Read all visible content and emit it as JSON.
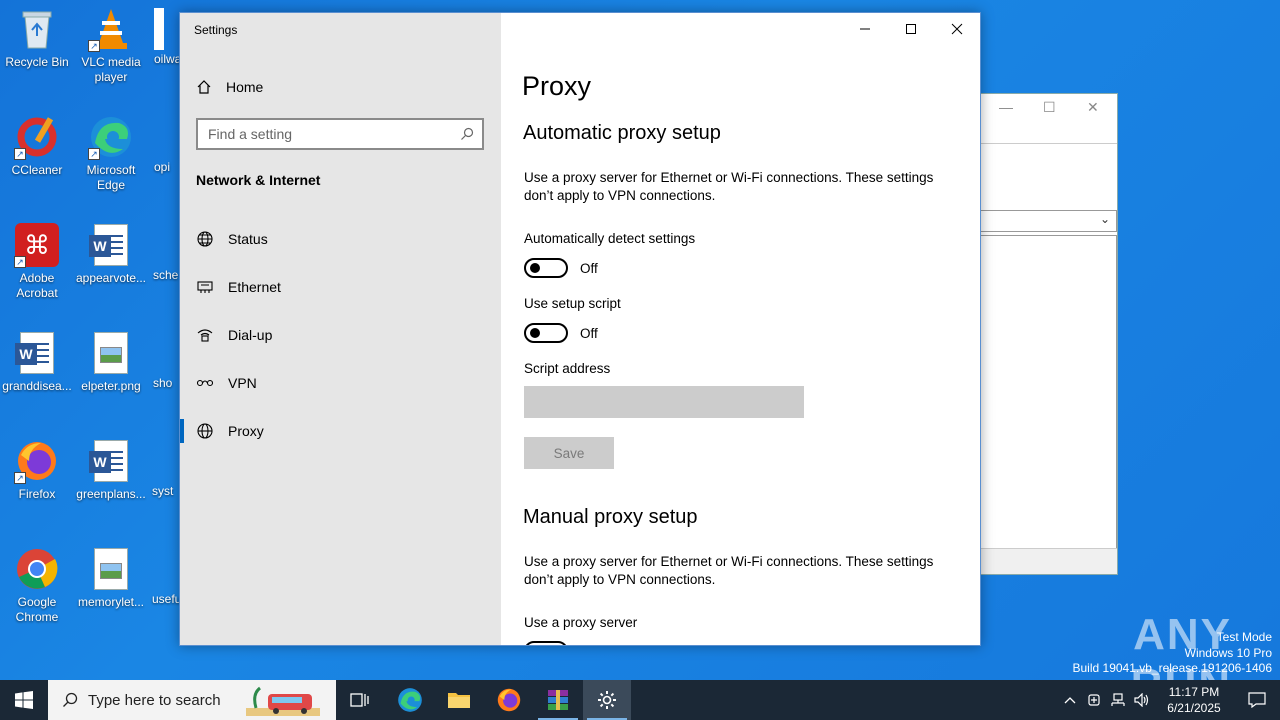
{
  "desktop": {
    "icons": [
      {
        "label": "Recycle Bin"
      },
      {
        "label": "VLC media player"
      },
      {
        "label": "oilwa"
      },
      {
        "label": "CCleaner"
      },
      {
        "label": "Microsoft Edge"
      },
      {
        "label": "opi"
      },
      {
        "label": "Adobe Acrobat"
      },
      {
        "label": "appearvote..."
      },
      {
        "label": "sche"
      },
      {
        "label": "granddisea..."
      },
      {
        "label": "elpeter.png"
      },
      {
        "label": "sho"
      },
      {
        "label": "Firefox"
      },
      {
        "label": "greenplans..."
      },
      {
        "label": "syst"
      },
      {
        "label": "Google Chrome"
      },
      {
        "label": "memorylet..."
      },
      {
        "label": "usefu"
      }
    ]
  },
  "settings": {
    "window_title": "Settings",
    "sidebar": {
      "home_label": "Home",
      "search_placeholder": "Find a setting",
      "section_title": "Network & Internet",
      "items": [
        {
          "label": "Status",
          "icon": "globe-status-icon"
        },
        {
          "label": "Ethernet",
          "icon": "ethernet-icon"
        },
        {
          "label": "Dial-up",
          "icon": "dialup-icon"
        },
        {
          "label": "VPN",
          "icon": "vpn-icon"
        },
        {
          "label": "Proxy",
          "icon": "globe-icon",
          "active": true
        }
      ]
    },
    "page_title": "Proxy",
    "automatic": {
      "heading": "Automatic proxy setup",
      "description": "Use a proxy server for Ethernet or Wi-Fi connections. These settings don’t apply to VPN connections.",
      "auto_detect_label": "Automatically detect settings",
      "auto_detect_state": "Off",
      "setup_script_label": "Use setup script",
      "setup_script_state": "Off",
      "script_address_label": "Script address",
      "script_address_value": "",
      "save_label": "Save"
    },
    "manual": {
      "heading": "Manual proxy setup",
      "description": "Use a proxy server for Ethernet or Wi-Fi connections. These settings don’t apply to VPN connections.",
      "use_proxy_label": "Use a proxy server"
    }
  },
  "watermark": {
    "logo": "ANY RUN",
    "line1": "Test Mode",
    "line2": "Windows 10 Pro",
    "line3": "Build 19041.vb_release.191206-1406"
  },
  "taskbar": {
    "search_placeholder": "Type here to search",
    "time": "11:17 PM",
    "date": "6/21/2025"
  },
  "colors": {
    "accent": "#0067c0",
    "desktop": "#1678dc",
    "taskbar": "#1b2836",
    "sidebar": "#e6e6e6"
  }
}
